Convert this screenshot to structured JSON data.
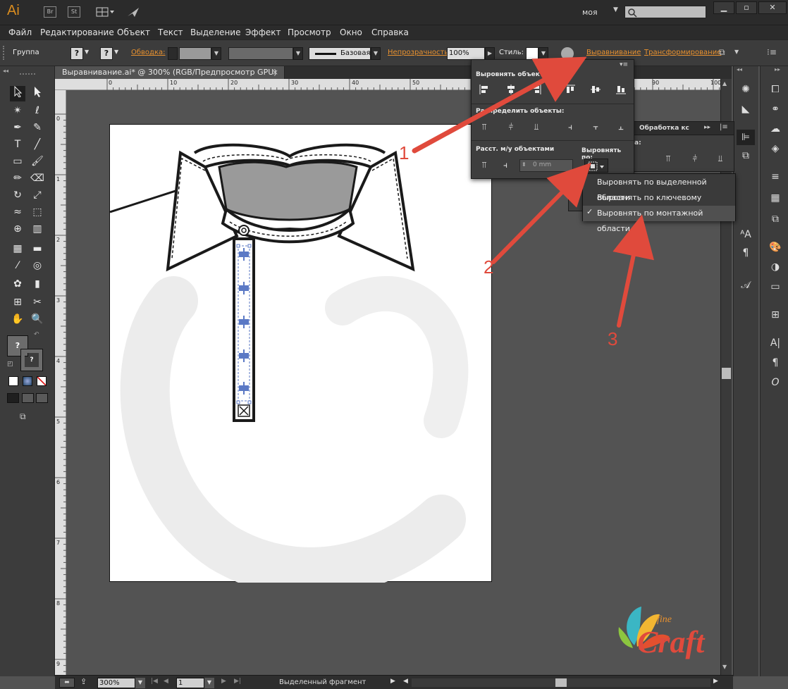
{
  "app": {
    "logo": "Ai",
    "bridge_badge": "Br",
    "stock_badge": "St",
    "workspace": "моя",
    "search_placeholder": ""
  },
  "window_controls": {
    "minimize": "▁",
    "restore": "▫",
    "close": "✕"
  },
  "menu": [
    "Файл",
    "Редактирование",
    "Объект",
    "Текст",
    "Выделение",
    "Эффект",
    "Просмотр",
    "Окно",
    "Справка"
  ],
  "control_bar": {
    "selection": "Группа",
    "fill_q": "?",
    "stroke_q": "?",
    "stroke_label": "Обводка:",
    "brush": "Базовая",
    "opacity_label": "Непрозрачность:",
    "opacity_value": "100%",
    "style_label": "Стиль:",
    "align_link": "Выравнивание",
    "transform_link": "Трансформирование"
  },
  "document_tab": {
    "title": "Выравнивание.ai* @ 300% (RGB/Предпросмотр GPU)",
    "close": "×"
  },
  "ruler": {
    "top_labels": [
      "0",
      "10",
      "20",
      "30",
      "40",
      "50",
      "60",
      "70",
      "80",
      "90",
      "100"
    ],
    "left_labels": [
      "0",
      "1",
      "2",
      "3",
      "4",
      "5",
      "6",
      "7",
      "8",
      "9"
    ]
  },
  "align_panel": {
    "align_objects": "Выровнять объекты:",
    "distribute_objects": "Распределить объекты:",
    "distribute_spacing": "Расст. м/у объектами",
    "align_to": "Выровнять по:",
    "spacing_value": "0 mm"
  },
  "background_panel": {
    "tab_label": "Обработка кс",
    "partial_label": "а:"
  },
  "align_to_dropdown": {
    "items": [
      {
        "label": "Выровнять по выделенной области",
        "checked": false
      },
      {
        "label": "Выровнять по ключевому объекту",
        "checked": false
      },
      {
        "label": "Выровнять по монтажной области",
        "checked": true
      }
    ],
    "check_mark": "✓"
  },
  "annotations": [
    "1",
    "2",
    "3"
  ],
  "status_bar": {
    "zoom": "300%",
    "artboard_number": "1",
    "status_text": "Выделенный фрагмент"
  },
  "watermark": {
    "small_text": "fine",
    "big_text": "Craft"
  },
  "colors": {
    "annotation_red": "#e04a3c",
    "orange_link": "#e8912f",
    "app_orange": "#d98c1f",
    "button_blue": "#5b79c5"
  }
}
